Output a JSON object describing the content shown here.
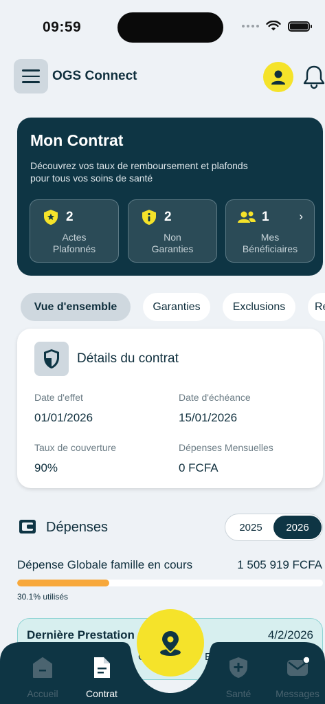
{
  "status_bar": {
    "time": "09:59"
  },
  "header": {
    "title": "OGS Connect"
  },
  "contract": {
    "title": "Mon Contrat",
    "description": "Découvrez vos taux de remboursement et plafonds pour tous vos soins de santé",
    "stats": [
      {
        "count": "2",
        "label_line1": "Actes",
        "label_line2": "Plafonnés",
        "icon": "star-shield-icon"
      },
      {
        "count": "2",
        "label_line1": "Non",
        "label_line2": "Garanties",
        "icon": "info-shield-icon"
      },
      {
        "count": "1",
        "label_line1": "Mes",
        "label_line2": "Bénéficiaires",
        "icon": "users-icon"
      }
    ]
  },
  "tabs": [
    "Vue d'ensemble",
    "Garanties",
    "Exclusions",
    "Re"
  ],
  "details": {
    "title": "Détails du contrat",
    "fields": [
      {
        "label": "Date d'effet",
        "value": "01/01/2026"
      },
      {
        "label": "Date d'échéance",
        "value": "15/01/2026"
      },
      {
        "label": "Taux de couverture",
        "value": "90%"
      },
      {
        "label": "Dépenses Mensuelles",
        "value": "0 FCFA"
      }
    ]
  },
  "depenses": {
    "title": "Dépenses",
    "years": [
      "2025",
      "2026"
    ],
    "selected_year": "2026",
    "global_label": "Dépense Globale famille en cours",
    "global_value": "1 505 919 FCFA",
    "used_fraction": 0.301,
    "used_text": "30.1% utilisés"
  },
  "last_service": {
    "title": "Dernière Prestation",
    "date": "4/2/2026",
    "sub_left": "CS",
    "sub_right": "E"
  },
  "nav": {
    "items": [
      {
        "label": "Accueil",
        "icon": "home-icon"
      },
      {
        "label": "Contrat",
        "icon": "document-icon"
      },
      {
        "label": "Santé",
        "icon": "health-shield-icon"
      },
      {
        "label": "Messages",
        "icon": "mail-icon"
      }
    ],
    "active": "Contrat",
    "fab_icon": "location-pin-icon"
  },
  "colors": {
    "primary": "#0e3544",
    "accent": "#f5e32a",
    "progress": "#f7a83b",
    "background": "#eef2f6"
  }
}
